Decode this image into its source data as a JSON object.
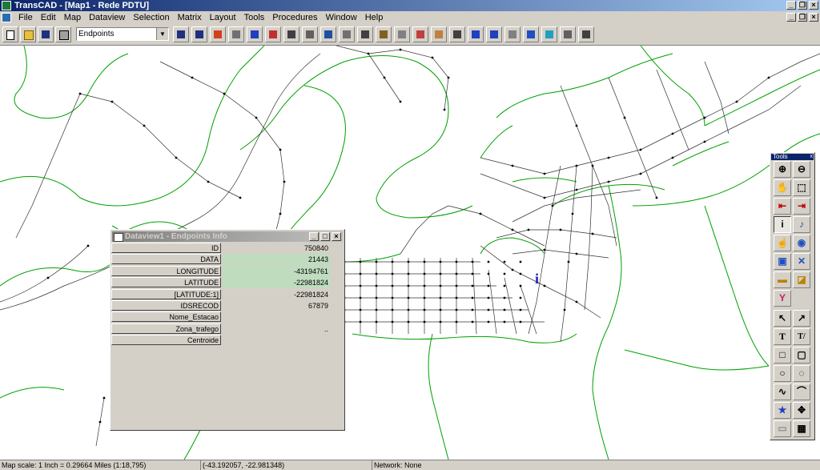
{
  "app": {
    "title": "TransCAD - [Map1 - Rede PDTU]"
  },
  "menu": [
    "File",
    "Edit",
    "Map",
    "Dataview",
    "Selection",
    "Matrix",
    "Layout",
    "Tools",
    "Procedures",
    "Window",
    "Help"
  ],
  "toolbar": {
    "layer_select_value": "Endpoints",
    "icons": [
      "new-icon",
      "open-icon",
      "save-icon",
      "print-icon",
      "dataview-icon",
      "chart-icon",
      "color-theme-icon",
      "dot-density-icon",
      "star-icon",
      "pie-icon",
      "network-icon",
      "route-icon",
      "layers-icon",
      "table-icon",
      "scale-icon",
      "eraser-icon",
      "palette-icon",
      "label-icon",
      "map-icon",
      "pin-icon",
      "grid-icon",
      "shape-icon",
      "globe-icon",
      "dbox-icon",
      "select-icon",
      "check-icon",
      "copy-icon"
    ]
  },
  "dataview": {
    "title": "Dataview1 - Endpoints Info",
    "rows": [
      {
        "label": "ID",
        "value": "750840"
      },
      {
        "label": "DATA",
        "value": "21443"
      },
      {
        "label": "LONGITUDE",
        "value": "-43194761"
      },
      {
        "label": "LATITUDE",
        "value": "-22981824"
      },
      {
        "label": "[LATITUDE:1]",
        "value": "-22981824"
      },
      {
        "label": "IDSRECOD",
        "value": "67879"
      },
      {
        "label": "Nome_Estacao",
        "value": ""
      },
      {
        "label": "Zona_trafego",
        "value": ".."
      },
      {
        "label": "Centroide",
        "value": ""
      }
    ]
  },
  "tools_panel": {
    "title": "Tools",
    "close": "x",
    "text_tool": "T",
    "text_tool2": "T/"
  },
  "map": {
    "info_marker": "i"
  },
  "status": {
    "scale": "Map scale: 1 Inch = 0.29664 Miles (1:18,795)",
    "coords": "(-43.192057, -22.981348)",
    "network": "Network: None"
  },
  "colors": {
    "zone_lines": "#00a000",
    "network_lines": "#303030",
    "title_active": "#0a246a"
  }
}
